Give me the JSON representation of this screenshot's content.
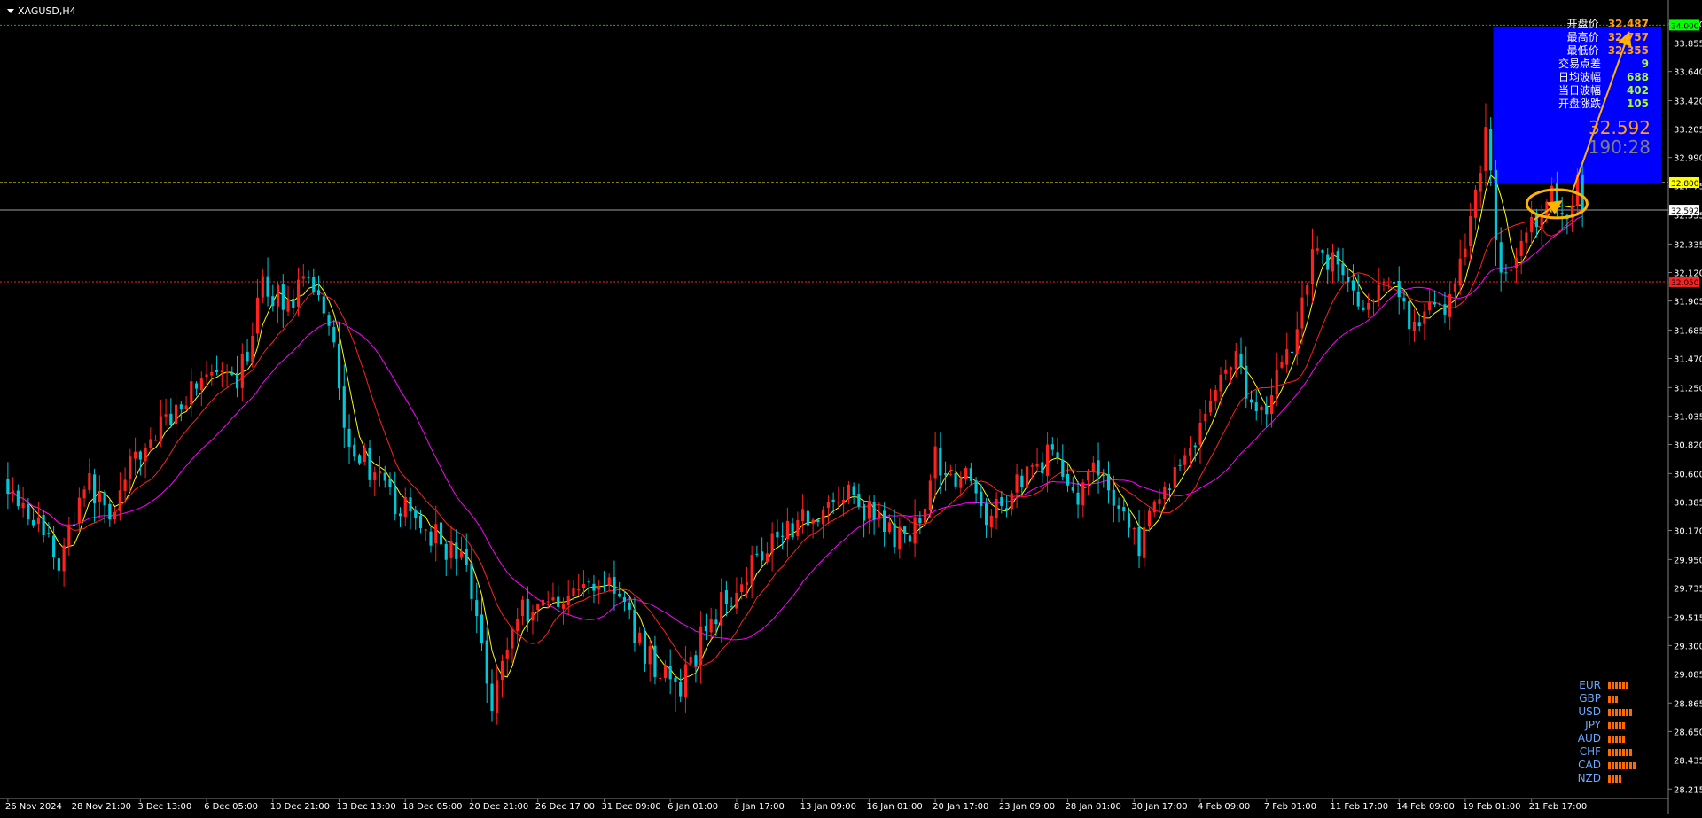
{
  "window": {
    "symbol_title": "XAGUSD,H4"
  },
  "info_panel": [
    {
      "label": "开盘价",
      "value": "32.487",
      "color": "#ff9f1a"
    },
    {
      "label": "最高价",
      "value": "32.757",
      "color": "#ff9f1a"
    },
    {
      "label": "最低价",
      "value": "32.355",
      "color": "#ff9f1a"
    },
    {
      "label": "交易点差",
      "value": "9",
      "color": "#adff2f"
    },
    {
      "label": "日均波幅",
      "value": "688",
      "color": "#adff2f"
    },
    {
      "label": "当日波幅",
      "value": "402",
      "color": "#adff2f"
    },
    {
      "label": "开盘涨跌",
      "value": "105",
      "color": "#adff2f"
    }
  ],
  "current_price": "32.592",
  "countdown": "190:28",
  "currency_strength": [
    {
      "name": "EUR",
      "bars": 6
    },
    {
      "name": "GBP",
      "bars": 3
    },
    {
      "name": "USD",
      "bars": 7
    },
    {
      "name": "JPY",
      "bars": 5
    },
    {
      "name": "AUD",
      "bars": 5
    },
    {
      "name": "CHF",
      "bars": 7
    },
    {
      "name": "CAD",
      "bars": 8
    },
    {
      "name": "NZD",
      "bars": 4
    }
  ],
  "chart_data": {
    "type": "candlestick",
    "title": "XAGUSD,H4",
    "ylim": [
      28.15,
      34.1
    ],
    "y_ticks": [
      "34.000",
      "33.855",
      "33.640",
      "33.420",
      "33.205",
      "32.990",
      "32.775",
      "32.555",
      "32.335",
      "32.120",
      "31.905",
      "31.685",
      "31.470",
      "31.250",
      "31.035",
      "30.820",
      "30.600",
      "30.385",
      "30.170",
      "29.950",
      "29.735",
      "29.515",
      "29.300",
      "29.085",
      "28.865",
      "28.650",
      "28.435",
      "28.215"
    ],
    "x_ticks": [
      "26 Nov 2024",
      "28 Nov 21:00",
      "3 Dec 13:00",
      "6 Dec 05:00",
      "10 Dec 21:00",
      "13 Dec 13:00",
      "18 Dec 05:00",
      "20 Dec 21:00",
      "26 Dec 17:00",
      "31 Dec 09:00",
      "6 Jan 01:00",
      "8 Jan 17:00",
      "13 Jan 09:00",
      "16 Jan 01:00",
      "20 Jan 17:00",
      "23 Jan 09:00",
      "28 Jan 01:00",
      "30 Jan 17:00",
      "4 Feb 09:00",
      "7 Feb 01:00",
      "11 Feb 17:00",
      "14 Feb 09:00",
      "19 Feb 01:00",
      "21 Feb 17:00"
    ],
    "num_candles": 310,
    "anchors": [
      [
        0,
        30.55
      ],
      [
        8,
        30.1
      ],
      [
        10,
        29.9
      ],
      [
        15,
        30.55
      ],
      [
        20,
        30.3
      ],
      [
        25,
        30.7
      ],
      [
        32,
        31.05
      ],
      [
        38,
        31.35
      ],
      [
        45,
        31.25
      ],
      [
        50,
        32.0
      ],
      [
        55,
        31.9
      ],
      [
        60,
        32.05
      ],
      [
        64,
        31.65
      ],
      [
        66,
        30.95
      ],
      [
        75,
        30.4
      ],
      [
        82,
        30.2
      ],
      [
        90,
        29.9
      ],
      [
        95,
        28.9
      ],
      [
        100,
        29.55
      ],
      [
        110,
        29.7
      ],
      [
        118,
        29.8
      ],
      [
        125,
        29.25
      ],
      [
        132,
        28.95
      ],
      [
        137,
        29.45
      ],
      [
        142,
        29.7
      ],
      [
        150,
        30.15
      ],
      [
        158,
        30.3
      ],
      [
        165,
        30.45
      ],
      [
        170,
        30.25
      ],
      [
        177,
        30.05
      ],
      [
        182,
        30.7
      ],
      [
        188,
        30.55
      ],
      [
        193,
        30.25
      ],
      [
        200,
        30.65
      ],
      [
        206,
        30.75
      ],
      [
        210,
        30.4
      ],
      [
        214,
        30.65
      ],
      [
        218,
        30.35
      ],
      [
        222,
        30.05
      ],
      [
        228,
        30.55
      ],
      [
        234,
        30.95
      ],
      [
        240,
        31.5
      ],
      [
        246,
        31.05
      ],
      [
        252,
        31.6
      ],
      [
        256,
        32.3
      ],
      [
        262,
        32.15
      ],
      [
        266,
        31.8
      ],
      [
        272,
        32.05
      ],
      [
        276,
        31.7
      ],
      [
        282,
        31.9
      ],
      [
        286,
        32.25
      ],
      [
        290,
        33.2
      ],
      [
        293,
        32.1
      ],
      [
        298,
        32.35
      ],
      [
        302,
        32.7
      ],
      [
        306,
        32.6
      ],
      [
        310,
        32.95
      ]
    ],
    "last_close": 32.592,
    "highest_high": 33.4,
    "lowest_low": 28.8,
    "horizontal_lines": [
      {
        "price": 33.99,
        "color": "#00c000",
        "style": "dotted",
        "label": "34.000"
      },
      {
        "price": 32.8,
        "color": "#ffff00",
        "style": "dashed",
        "label": "32.800"
      },
      {
        "price": 32.592,
        "color": "#a0a0a0",
        "style": "solid",
        "label": "32.592"
      },
      {
        "price": 32.05,
        "color": "#ff2020",
        "style": "dotted",
        "label": "32.050"
      }
    ],
    "target_box": {
      "x_start": 292,
      "x_end": 325,
      "price_low": 32.8,
      "price_high": 33.98,
      "color": "#0000ff"
    },
    "ellipse": {
      "center_x": 304,
      "center_price": 32.64,
      "color": "#ffb400"
    },
    "arrows": [
      {
        "from": [
          299.5,
          32.52
        ],
        "to": [
          304.5,
          32.65
        ],
        "color": "#ffb400"
      },
      {
        "from": [
          307,
          32.73
        ],
        "to": [
          318,
          33.92
        ],
        "color": "#ffb400"
      }
    ],
    "moving_averages": [
      {
        "period": 5,
        "color": "#ffff00"
      },
      {
        "period": 12,
        "color": "#ff2020"
      },
      {
        "period": 24,
        "color": "#ff00ff"
      }
    ],
    "bull_color": "#ff2020",
    "bear_color": "#00c8d8",
    "grid": false,
    "price_tag_colors": {
      "32.800": "#ffff00",
      "32.592": "#ffffff",
      "34.000": "#00ff00",
      "32.050": "#ff2020"
    }
  }
}
